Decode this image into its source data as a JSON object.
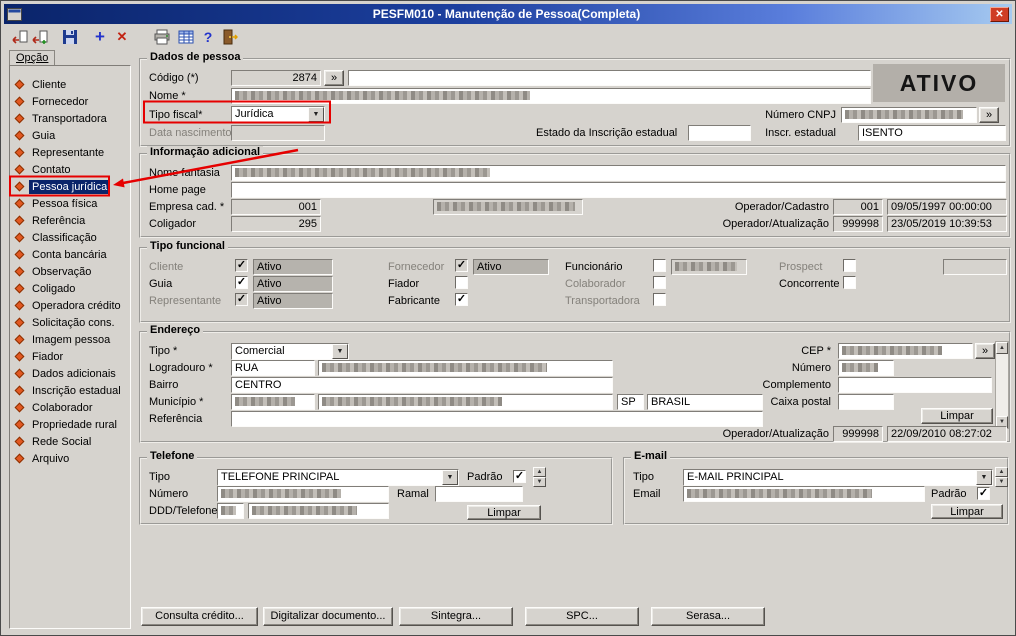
{
  "ui": {
    "lookup": "»",
    "combo_arrow": "▼",
    "up_arrow": "▲",
    "down_arrow": "▼",
    "check": "✓",
    "close": "✕"
  },
  "colors": {
    "titlebar_start": "#0a246a",
    "titlebar_end": "#a6caf0",
    "window_bg": "#d6d3ce",
    "annotation_red": "#e60000",
    "selection_blue": "#0a246a",
    "bullet_orange": "#e25822",
    "status_box_gray": "#b3afa9"
  },
  "window": {
    "title": "PESFM010 - Manutenção de Pessoa(Completa)"
  },
  "toolbar": {
    "icons": [
      "return-icon",
      "return-new-icon",
      "save-icon",
      "add-icon",
      "delete-icon",
      "print-icon",
      "grid-icon",
      "help-icon",
      "exit-icon"
    ],
    "add_glyph": "+",
    "delete_glyph": "✕",
    "help_glyph": "?"
  },
  "sidebar": {
    "tab": "Opção",
    "selected": "Pessoa jurídica",
    "items": [
      "Cliente",
      "Fornecedor",
      "Transportadora",
      "Guia",
      "Representante",
      "Contato",
      "Pessoa jurídica",
      "Pessoa física",
      "Referência",
      "Classificação",
      "Conta bancária",
      "Observação",
      "Coligado",
      "Operadora crédito",
      "Solicitação cons.",
      "Imagem pessoa",
      "Fiador",
      "Dados adicionais",
      "Inscrição estadual",
      "Colaborador",
      "Propriedade rural",
      "Rede Social",
      "Arquivo"
    ]
  },
  "dados": {
    "title": "Dados de pessoa",
    "codigo_label": "Código (*)",
    "codigo_value": "2874",
    "nome_label": "Nome *",
    "tipo_fiscal_label": "Tipo fiscal*",
    "tipo_fiscal_value": "Jurídica",
    "data_nascimento_label": "Data nascimento",
    "status_banner": "ATIVO",
    "cnpj_label": "Número CNPJ",
    "estado_ie_label": "Estado da Inscrição estadual",
    "ie_label": "Inscr. estadual",
    "ie_value": "ISENTO"
  },
  "info": {
    "title": "Informação adicional",
    "nome_fantasia_label": "Nome fantasia",
    "home_page_label": "Home page",
    "empresa_label": "Empresa cad. *",
    "empresa_value": "001",
    "coligador_label": "Coligador",
    "coligador_value": "295",
    "op_cadastro_label": "Operador/Cadastro",
    "op_cadastro_id": "001",
    "op_cadastro_dt": "09/05/1997 00:00:00",
    "op_atualizacao_label": "Operador/Atualização",
    "op_atualizacao_id": "999998",
    "op_atualizacao_dt": "23/05/2019 10:39:53"
  },
  "funcional": {
    "title": "Tipo funcional",
    "ativo": "Ativo",
    "labels": {
      "cliente": "Cliente",
      "guia": "Guia",
      "representante": "Representante",
      "fornecedor": "Fornecedor",
      "fiador": "Fiador",
      "fabricante": "Fabricante",
      "funcionario": "Funcionário",
      "colaborador": "Colaborador",
      "transportadora": "Transportadora",
      "prospect": "Prospect",
      "concorrente": "Concorrente"
    }
  },
  "endereco": {
    "title": "Endereço",
    "tipo_label": "Tipo *",
    "tipo_value": "Comercial",
    "logradouro_label": "Logradouro *",
    "logradouro_tipo": "RUA",
    "bairro_label": "Bairro",
    "bairro_value": "CENTRO",
    "municipio_label": "Município *",
    "uf_value": "SP",
    "pais_value": "BRASIL",
    "referencia_label": "Referência",
    "cep_label": "CEP *",
    "numero_label": "Número",
    "complemento_label": "Complemento",
    "caixa_postal_label": "Caixa postal",
    "limpar_label": "Limpar",
    "op_atualizacao_label": "Operador/Atualização",
    "op_atualizacao_id": "999998",
    "op_atualizacao_dt": "22/09/2010 08:27:02"
  },
  "telefone": {
    "title": "Telefone",
    "tipo_label": "Tipo",
    "tipo_value": "TELEFONE PRINCIPAL",
    "padrao_label": "Padrão",
    "numero_label": "Número",
    "ramal_label": "Ramal",
    "ddd_label": "DDD/Telefone",
    "limpar_label": "Limpar"
  },
  "email": {
    "title": "E-mail",
    "tipo_label": "Tipo",
    "tipo_value": "E-MAIL PRINCIPAL",
    "email_label": "Email",
    "padrao_label": "Padrão",
    "limpar_label": "Limpar"
  },
  "footer": {
    "buttons": [
      "Consulta crédito...",
      "Digitalizar documento...",
      "Sintegra...",
      "SPC...",
      "Serasa..."
    ]
  }
}
